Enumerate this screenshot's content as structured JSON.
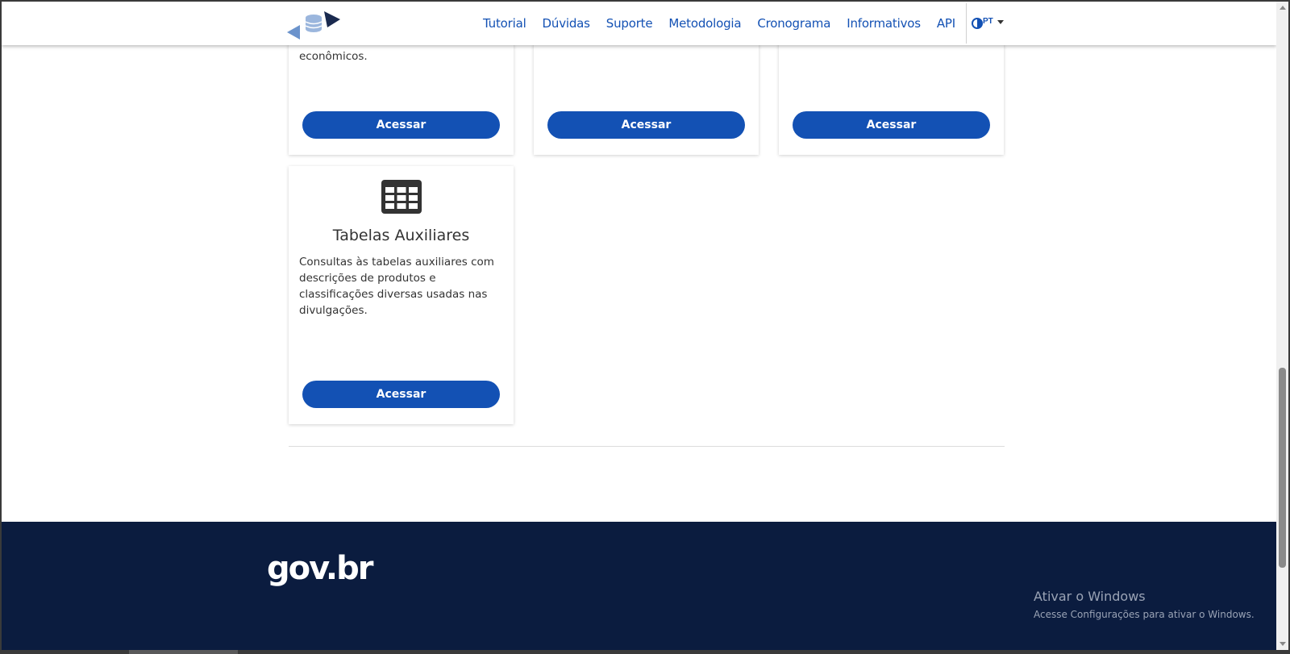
{
  "nav": {
    "items": [
      "Tutorial",
      "Dúvidas",
      "Suporte",
      "Metodologia",
      "Cronograma",
      "Informativos",
      "API"
    ],
    "language": "PT"
  },
  "cards_top": {
    "text_card1": "econômicos.",
    "button_label": "Acessar"
  },
  "card_tabelas": {
    "title": "Tabelas Auxiliares",
    "description": "Consultas às tabelas auxiliares com descrições de produtos e classificações diversas usadas nas divulgações.",
    "button_label": "Acessar"
  },
  "footer": {
    "brand": "gov.br"
  },
  "watermark": {
    "title": "Ativar o Windows",
    "subtitle": "Acesse Configurações para ativar o Windows."
  },
  "colors": {
    "primary": "#1351b4",
    "footer_bg": "#0b1c3f"
  },
  "icons": {
    "logo": "database-arrows-logo",
    "contrast": "contrast-icon",
    "table": "table-icon"
  }
}
